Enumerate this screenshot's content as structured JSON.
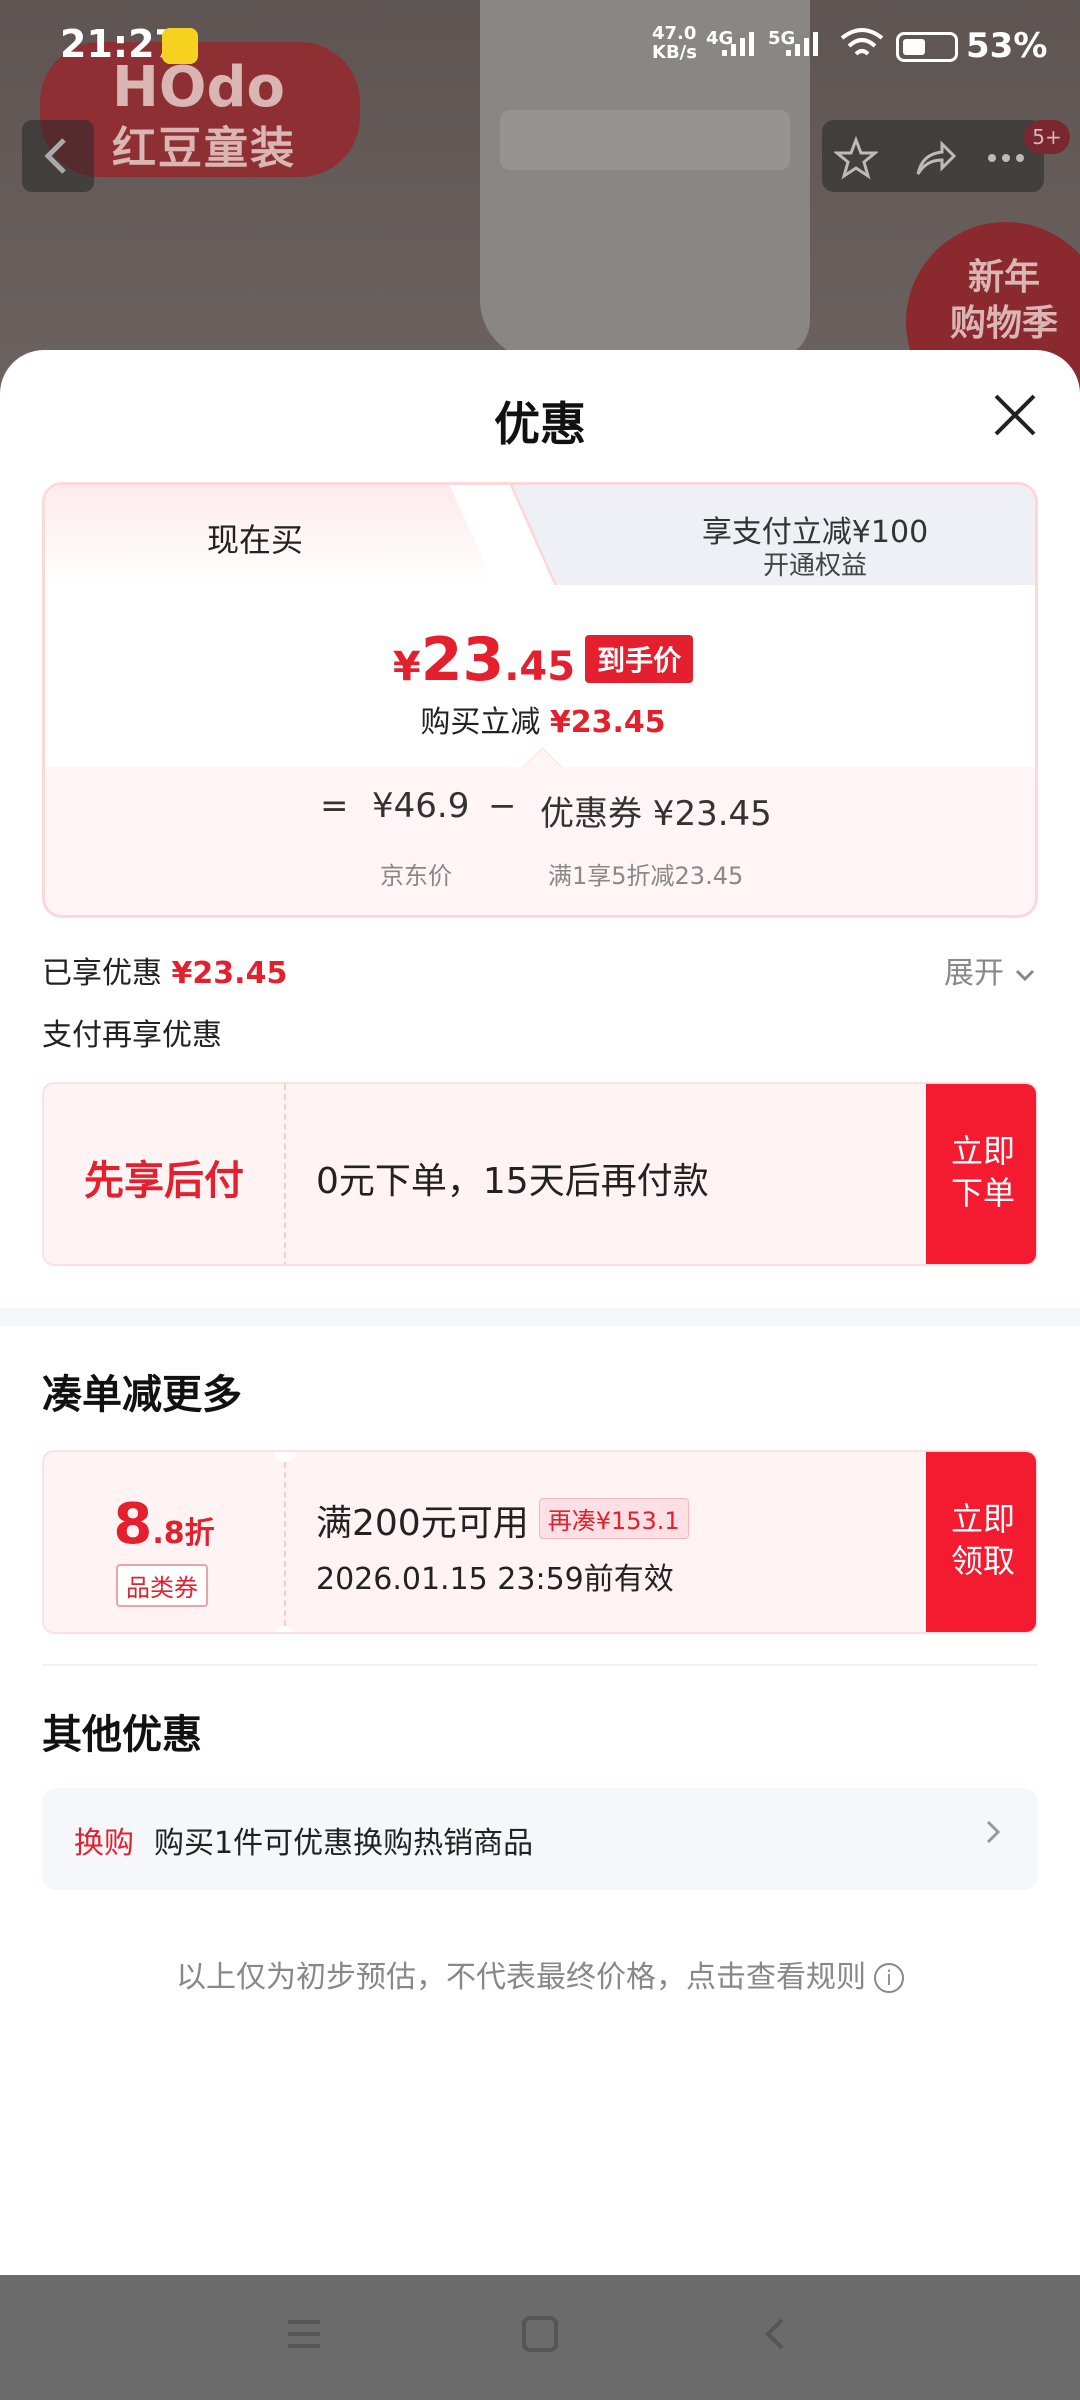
{
  "status_bar": {
    "time": "21:27",
    "net_speed_top": "47.0",
    "net_speed_bottom": "KB/s",
    "sig1": "4G",
    "sig2": "5G",
    "battery": "53%"
  },
  "background": {
    "brand_logo": "HOdo",
    "brand_sub": "红豆童装",
    "promo": "新年\n购物季",
    "cart_badge": "5+"
  },
  "sheet": {
    "title": "优惠",
    "tabs": [
      {
        "label": "现在买"
      },
      {
        "label": "享支付立减¥100",
        "sub": "开通权益"
      }
    ],
    "price": {
      "yen": "¥",
      "int": "23",
      "dec": ".45",
      "tag": "到手价",
      "sub_label": "购买立减",
      "sub_value": "¥23.45"
    },
    "calc": {
      "eq": "=",
      "jd_price": "¥46.9",
      "minus": "−",
      "coupon": "优惠券 ¥23.45",
      "jd_label": "京东价",
      "coupon_label": "满1享5折减23.45"
    },
    "enjoyed_label": "已享优惠",
    "enjoyed_value": "¥23.45",
    "expand_label": "展开",
    "pay_more_label": "支付再享优惠",
    "bnpl": {
      "title": "先享后付",
      "desc": "0元下单，15天后再付款",
      "button": "立即\n下单"
    },
    "more_title": "凑单减更多",
    "coupon_card": {
      "big": "8",
      "small": ".8折",
      "tag": "品类券",
      "condition": "满200元可用",
      "extra": "再凑¥153.1",
      "valid": "2026.01.15 23:59前有效",
      "button": "立即\n领取"
    },
    "other_title": "其他优惠",
    "other_row": {
      "tag": "换购",
      "text": "购买1件可优惠换购热销商品"
    },
    "footnote": "以上仅为初步预估，不代表最终价格，点击查看规则"
  },
  "icons": {
    "back": "back-icon",
    "star": "star-icon",
    "share": "share-icon",
    "more": "more-icon",
    "close": "close-icon",
    "chevron_down": "chevron-down-icon",
    "chevron_right": "chevron-right-icon",
    "info": "info-icon"
  },
  "colors": {
    "accent": "#e5202e",
    "button": "#f41b30"
  }
}
